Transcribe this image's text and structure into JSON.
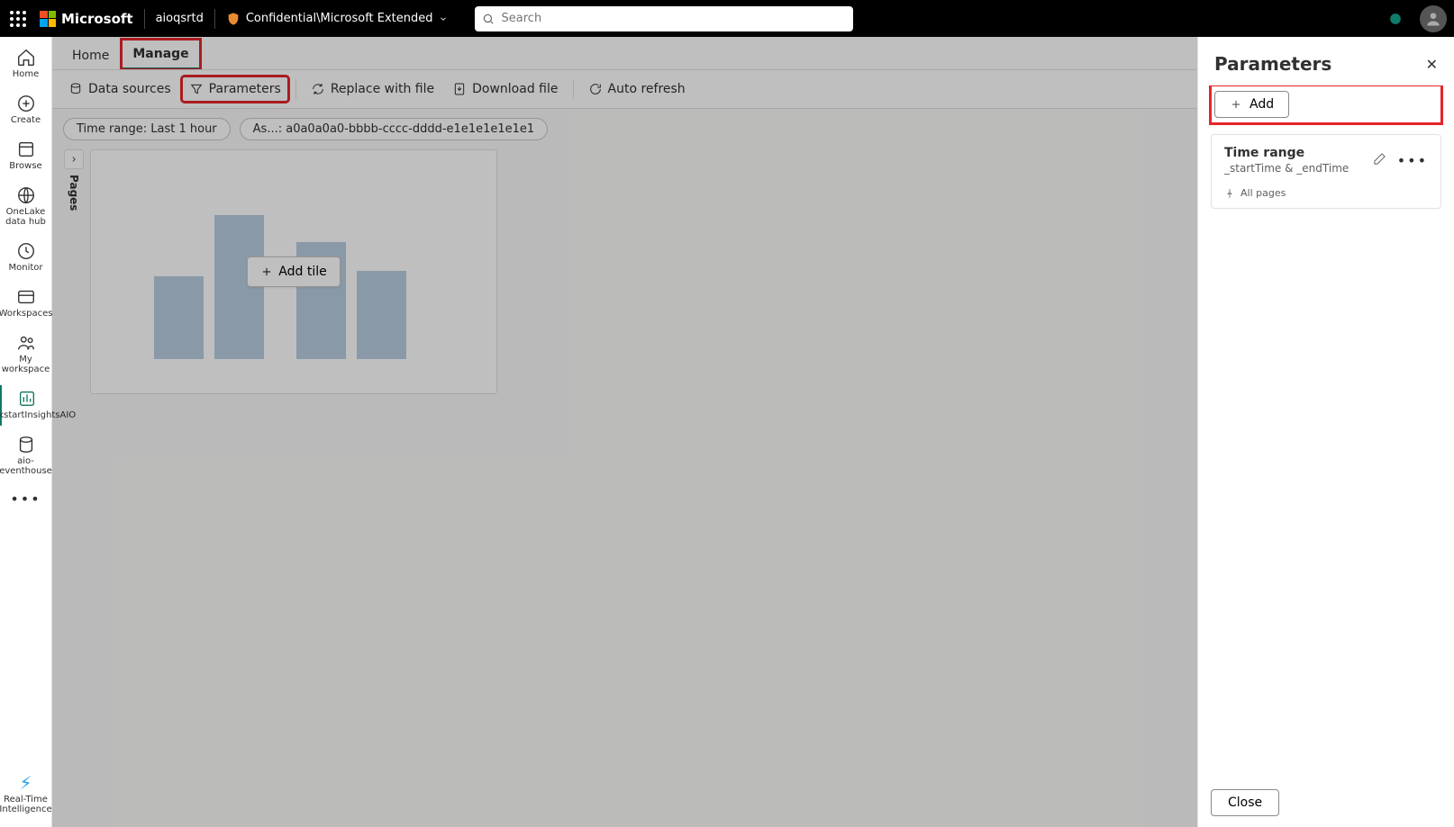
{
  "topbar": {
    "brand": "Microsoft",
    "workspace": "aioqsrtd",
    "sensitivity": "Confidential\\Microsoft Extended",
    "search_placeholder": "Search"
  },
  "leftnav": {
    "items": [
      {
        "label": "Home"
      },
      {
        "label": "Create"
      },
      {
        "label": "Browse"
      },
      {
        "label": "OneLake data hub"
      },
      {
        "label": "Monitor"
      },
      {
        "label": "Workspaces"
      },
      {
        "label": "My workspace"
      },
      {
        "label": "QuickstartInsightsAIO"
      },
      {
        "label": "aio-eventhouse"
      }
    ],
    "bottom": "Real-Time Intelligence"
  },
  "tabs": {
    "home": "Home",
    "manage": "Manage"
  },
  "toolbar": {
    "data_sources": "Data sources",
    "parameters": "Parameters",
    "replace": "Replace with file",
    "download": "Download file",
    "auto_refresh": "Auto refresh"
  },
  "chips": {
    "time_range": "Time range: Last 1 hour",
    "asset": "As...: a0a0a0a0-bbbb-cccc-dddd-e1e1e1e1e1e1"
  },
  "pages_label": "Pages",
  "add_tile": "Add tile",
  "panel": {
    "title": "Parameters",
    "add": "Add",
    "card": {
      "title": "Time range",
      "subtitle": "_startTime & _endTime",
      "scope": "All pages"
    },
    "close": "Close"
  }
}
